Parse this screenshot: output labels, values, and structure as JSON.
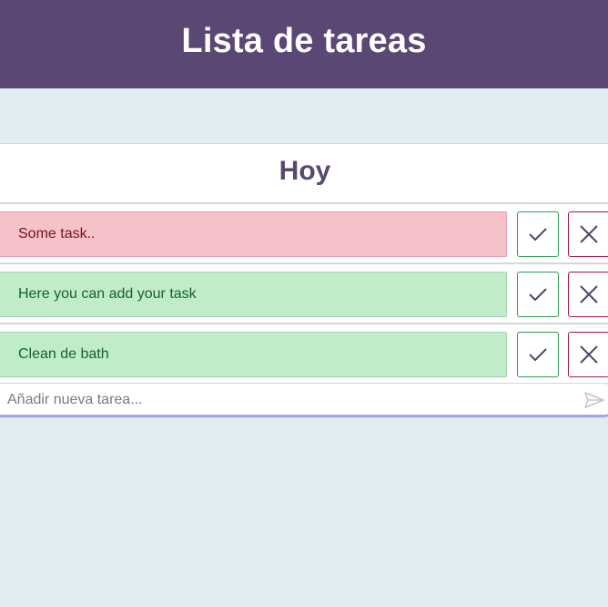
{
  "header": {
    "title": "Lista de tareas"
  },
  "list": {
    "title": "Hoy",
    "tasks": [
      {
        "text": "Some task..",
        "status": "pending"
      },
      {
        "text": "Here you can add your task",
        "status": "done"
      },
      {
        "text": "Clean de bath",
        "status": "done"
      }
    ]
  },
  "new_task": {
    "placeholder": "Añadir nueva tarea..."
  },
  "colors": {
    "header_bg": "#5a4773",
    "page_bg": "#e0edf1",
    "pending_bg": "#f6c2c9",
    "done_bg": "#c0ecca",
    "check_border": "#2f9a55",
    "delete_border": "#a01a3a"
  },
  "icons": {
    "check": "check-icon",
    "delete": "close-icon",
    "send": "send-icon"
  }
}
